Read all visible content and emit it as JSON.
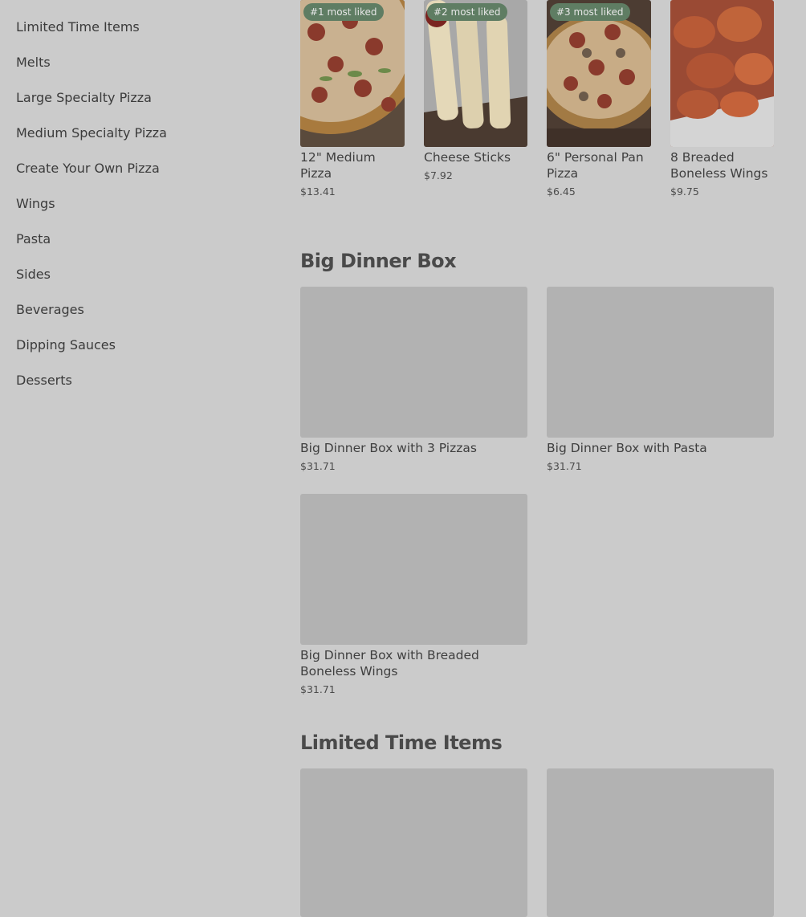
{
  "sidebar": {
    "items": [
      {
        "label": "Limited Time Items"
      },
      {
        "label": "Melts"
      },
      {
        "label": "Large Specialty Pizza"
      },
      {
        "label": "Medium Specialty Pizza"
      },
      {
        "label": "Create Your Own Pizza"
      },
      {
        "label": "Wings"
      },
      {
        "label": "Pasta"
      },
      {
        "label": "Sides"
      },
      {
        "label": "Beverages"
      },
      {
        "label": "Dipping Sauces"
      },
      {
        "label": "Desserts"
      }
    ]
  },
  "most_liked": {
    "items": [
      {
        "badge": "#1 most liked",
        "name": "12\" Medium Pizza",
        "price": "$13.41",
        "image": "pizza-photo"
      },
      {
        "badge": "#2 most liked",
        "name": "Cheese Sticks",
        "price": "$7.92",
        "image": "cheese-sticks-photo"
      },
      {
        "badge": "#3 most liked",
        "name": "6\" Personal Pan Pizza",
        "price": "$6.45",
        "image": "pan-pizza-photo"
      },
      {
        "badge": "",
        "name": "8 Breaded Boneless Wings",
        "price": "$9.75",
        "image": "wings-photo"
      }
    ]
  },
  "big_dinner_box": {
    "title": "Big Dinner Box",
    "items": [
      {
        "name": "Big Dinner Box with 3 Pizzas",
        "price": "$31.71"
      },
      {
        "name": "Big Dinner Box with Pasta",
        "price": "$31.71"
      },
      {
        "name": "Big Dinner Box with Breaded Boneless Wings",
        "price": "$31.71"
      }
    ]
  },
  "limited_time": {
    "title": "Limited Time Items"
  },
  "colors": {
    "background": "#cbcbcb",
    "badge": "#5f7d63",
    "placeholder": "#b2b2b2"
  }
}
